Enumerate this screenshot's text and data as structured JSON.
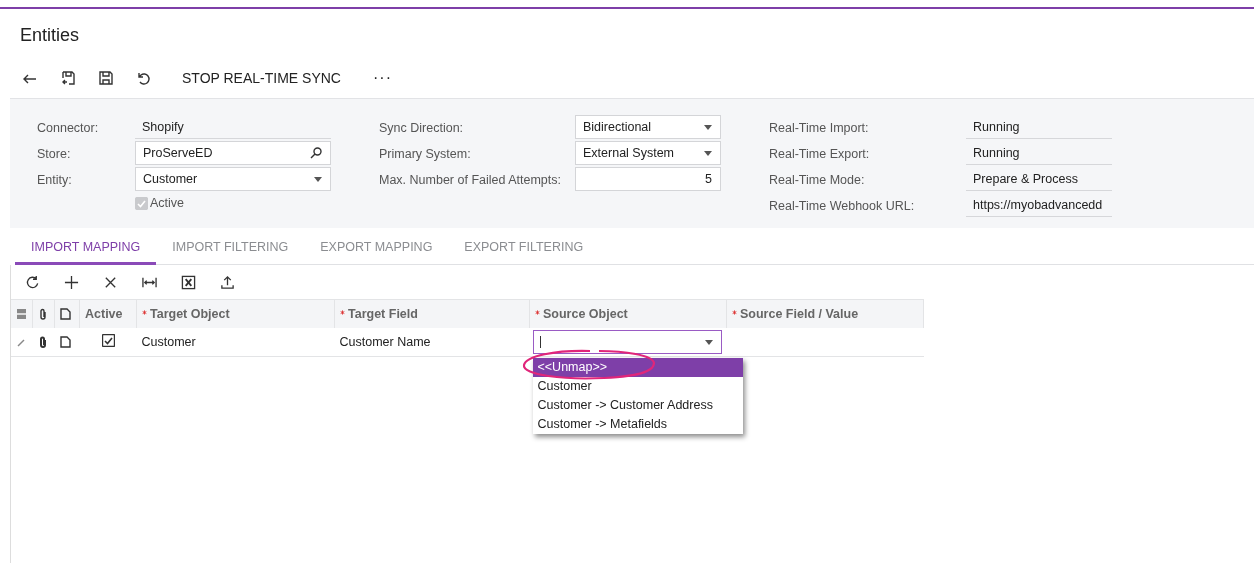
{
  "title": "Entities",
  "toolbar": {
    "action": "STOP REAL-TIME SYNC",
    "more": "···"
  },
  "form": {
    "columns": [
      [
        {
          "kind": "text",
          "label": "Connector:",
          "value": "Shopify"
        },
        {
          "kind": "search",
          "label": "Store:",
          "value": "ProServeED"
        },
        {
          "kind": "select",
          "label": "Entity:",
          "value": "Customer"
        },
        {
          "kind": "checkbox",
          "label": "Active",
          "checked": true,
          "disabled": true
        }
      ],
      [
        {
          "kind": "select",
          "label": "Sync Direction:",
          "value": "Bidirectional"
        },
        {
          "kind": "select",
          "label": "Primary System:",
          "value": "External System"
        },
        {
          "kind": "number",
          "label": "Max. Number of Failed Attempts:",
          "value": "5"
        }
      ],
      [
        {
          "kind": "text",
          "label": "Real-Time Import:",
          "value": "Running"
        },
        {
          "kind": "text",
          "label": "Real-Time Export:",
          "value": "Running"
        },
        {
          "kind": "text",
          "label": "Real-Time Mode:",
          "value": "Prepare & Process"
        },
        {
          "kind": "text",
          "label": "Real-Time Webhook URL:",
          "value": "https://myobadvancedd"
        }
      ]
    ]
  },
  "tabs": [
    {
      "label": "IMPORT MAPPING",
      "selected": true
    },
    {
      "label": "IMPORT FILTERING",
      "selected": false
    },
    {
      "label": "EXPORT MAPPING",
      "selected": false
    },
    {
      "label": "EXPORT FILTERING",
      "selected": false
    }
  ],
  "grid": {
    "columns": [
      {
        "label": "Active",
        "required": false
      },
      {
        "label": "Target Object",
        "required": true
      },
      {
        "label": "Target Field",
        "required": true
      },
      {
        "label": "Source Object",
        "required": true
      },
      {
        "label": "Source Field / Value",
        "required": true
      }
    ],
    "rows": [
      {
        "active": true,
        "target_object": "Customer",
        "target_field": "Customer Name",
        "editing": true
      }
    ],
    "dropdown": {
      "options": [
        {
          "label": "<<Unmap>>",
          "selected": true
        },
        {
          "label": "Customer",
          "selected": false
        },
        {
          "label": "Customer -> Customer Address",
          "selected": false
        },
        {
          "label": "Customer -> Metafields",
          "selected": false
        }
      ]
    }
  }
}
